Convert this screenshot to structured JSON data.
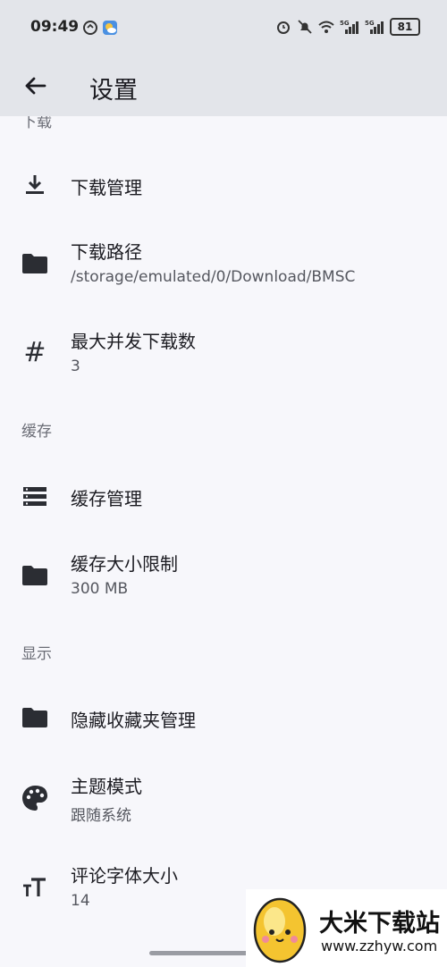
{
  "status_bar": {
    "time": "09:49",
    "battery": "81",
    "left_icons": [
      "sync-icon",
      "weather-icon"
    ],
    "right_icons": [
      "alarm-icon",
      "mute-icon",
      "wifi-icon",
      "signal-5g-icon",
      "signal-5g-icon"
    ]
  },
  "app_bar": {
    "title": "设置",
    "back_icon": "arrow-back-icon"
  },
  "sections": {
    "download": {
      "header": "下载"
    },
    "cache": {
      "header": "缓存"
    },
    "display": {
      "header": "显示"
    }
  },
  "items": {
    "download_manage": {
      "title": "下载管理",
      "icon": "download-icon"
    },
    "download_path": {
      "title": "下载路径",
      "subtitle": "/storage/emulated/0/Download/BMSC",
      "icon": "folder-icon"
    },
    "max_downloads": {
      "title": "最大并发下载数",
      "subtitle": "3",
      "icon": "hash-icon"
    },
    "cache_manage": {
      "title": "缓存管理",
      "icon": "storage-icon"
    },
    "cache_limit": {
      "title": "缓存大小限制",
      "subtitle": "300 MB",
      "icon": "folder-icon"
    },
    "hidden_favs": {
      "title": "隐藏收藏夹管理",
      "icon": "folder-icon"
    },
    "theme_mode": {
      "title": "主题模式",
      "subtitle": "跟随系统",
      "icon": "palette-icon"
    },
    "comment_font": {
      "title": "评论字体大小",
      "subtitle": "14",
      "icon": "text-size-icon"
    }
  },
  "watermark": {
    "name": "大米下载站",
    "url": "www.zzhyw.com"
  },
  "colors": {
    "background": "#f7f7fb",
    "bar": "#e3e5ea",
    "icon": "#2b2d33",
    "section_text": "#6b6d76"
  }
}
